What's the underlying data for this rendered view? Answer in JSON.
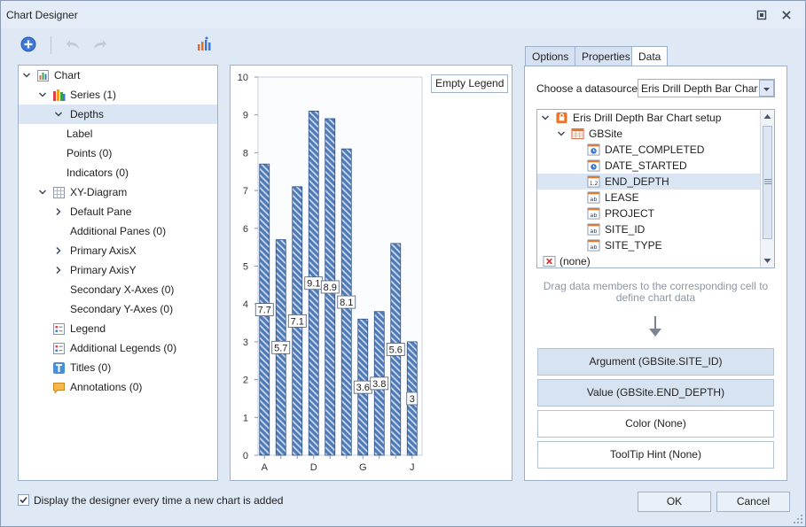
{
  "window": {
    "title": "Chart Designer"
  },
  "tree": [
    {
      "label": "Chart",
      "level": 0,
      "expander": "expanded",
      "icon": "chart-icon"
    },
    {
      "label": "Series (1)",
      "level": 1,
      "expander": "expanded",
      "icon": "series-icon"
    },
    {
      "label": "Depths",
      "level": 2,
      "expander": "expanded",
      "icon": "",
      "selected": true
    },
    {
      "label": "Label",
      "level": 3,
      "expander": "",
      "icon": ""
    },
    {
      "label": "Points (0)",
      "level": 3,
      "expander": "",
      "icon": ""
    },
    {
      "label": "Indicators (0)",
      "level": 3,
      "expander": "",
      "icon": ""
    },
    {
      "label": "XY-Diagram",
      "level": 1,
      "expander": "expanded",
      "icon": "diagram-icon"
    },
    {
      "label": "Default Pane",
      "level": 2,
      "expander": "collapsed",
      "icon": ""
    },
    {
      "label": "Additional Panes (0)",
      "level": 2,
      "expander": "",
      "icon": ""
    },
    {
      "label": "Primary AxisX",
      "level": 2,
      "expander": "collapsed",
      "icon": ""
    },
    {
      "label": "Primary AxisY",
      "level": 2,
      "expander": "collapsed",
      "icon": ""
    },
    {
      "label": "Secondary X-Axes (0)",
      "level": 2,
      "expander": "",
      "icon": ""
    },
    {
      "label": "Secondary Y-Axes (0)",
      "level": 2,
      "expander": "",
      "icon": ""
    },
    {
      "label": "Legend",
      "level": 1,
      "expander": "",
      "icon": "legend-icon"
    },
    {
      "label": "Additional Legends (0)",
      "level": 1,
      "expander": "",
      "icon": "legend-icon"
    },
    {
      "label": "Titles (0)",
      "level": 1,
      "expander": "",
      "icon": "titles-icon"
    },
    {
      "label": "Annotations (0)",
      "level": 1,
      "expander": "",
      "icon": "annotation-icon"
    }
  ],
  "tabs": [
    {
      "label": "Options",
      "active": false
    },
    {
      "label": "Properties",
      "active": false
    },
    {
      "label": "Data",
      "active": true
    }
  ],
  "datasource": {
    "label": "Choose a datasource:",
    "selected": "Eris Drill Depth Bar Chart setup"
  },
  "ds_tree": [
    {
      "label": "Eris Drill Depth Bar Chart setup",
      "level": 0,
      "expander": "expanded",
      "icon": "datasource-icon"
    },
    {
      "label": "GBSite",
      "level": 1,
      "expander": "expanded",
      "icon": "table-icon"
    },
    {
      "label": "DATE_COMPLETED",
      "level": 2,
      "expander": "",
      "icon": "date-field-icon"
    },
    {
      "label": "DATE_STARTED",
      "level": 2,
      "expander": "",
      "icon": "date-field-icon"
    },
    {
      "label": "END_DEPTH",
      "level": 2,
      "expander": "",
      "icon": "number-field-icon",
      "selected": true
    },
    {
      "label": "LEASE",
      "level": 2,
      "expander": "",
      "icon": "text-field-icon"
    },
    {
      "label": "PROJECT",
      "level": 2,
      "expander": "",
      "icon": "text-field-icon"
    },
    {
      "label": "SITE_ID",
      "level": 2,
      "expander": "",
      "icon": "text-field-icon"
    },
    {
      "label": "SITE_TYPE",
      "level": 2,
      "expander": "",
      "icon": "text-field-icon"
    },
    {
      "label": "(none)",
      "level": 0,
      "expander": "",
      "icon": "none-icon"
    }
  ],
  "hint": "Drag data members to the corresponding cell to define chart data",
  "cells": [
    {
      "label": "Argument (GBSite.SITE_ID)",
      "filled": true
    },
    {
      "label": "Value (GBSite.END_DEPTH)",
      "filled": true
    },
    {
      "label": "Color (None)",
      "filled": false
    },
    {
      "label": "ToolTip Hint (None)",
      "filled": false
    }
  ],
  "footer": {
    "checkbox_label": "Display the designer every time a new chart is added",
    "checked": true,
    "ok": "OK",
    "cancel": "Cancel"
  },
  "colors": {
    "bar_fill": "#4f7ab8",
    "bar_stripe": "#c9d7ea",
    "accent": "#3c78d8"
  },
  "chart_data": {
    "type": "bar",
    "legend": "Empty Legend",
    "ylim": [
      0,
      10
    ],
    "yticks": [
      "0",
      "1",
      "2",
      "3",
      "4",
      "5",
      "6",
      "7",
      "8",
      "9",
      "10"
    ],
    "x_tick_labels": [
      "A",
      "",
      "",
      "D",
      "",
      "",
      "G",
      "",
      "",
      "J"
    ],
    "values": [
      7.7,
      5.7,
      7.1,
      9.1,
      8.9,
      8.1,
      3.6,
      3.8,
      5.6,
      3
    ],
    "data_labels": [
      "7.7",
      "5.7",
      "7.1",
      "9.1",
      "8.9",
      "8.1",
      "3.6",
      "3.8",
      "5.6",
      "3"
    ]
  }
}
